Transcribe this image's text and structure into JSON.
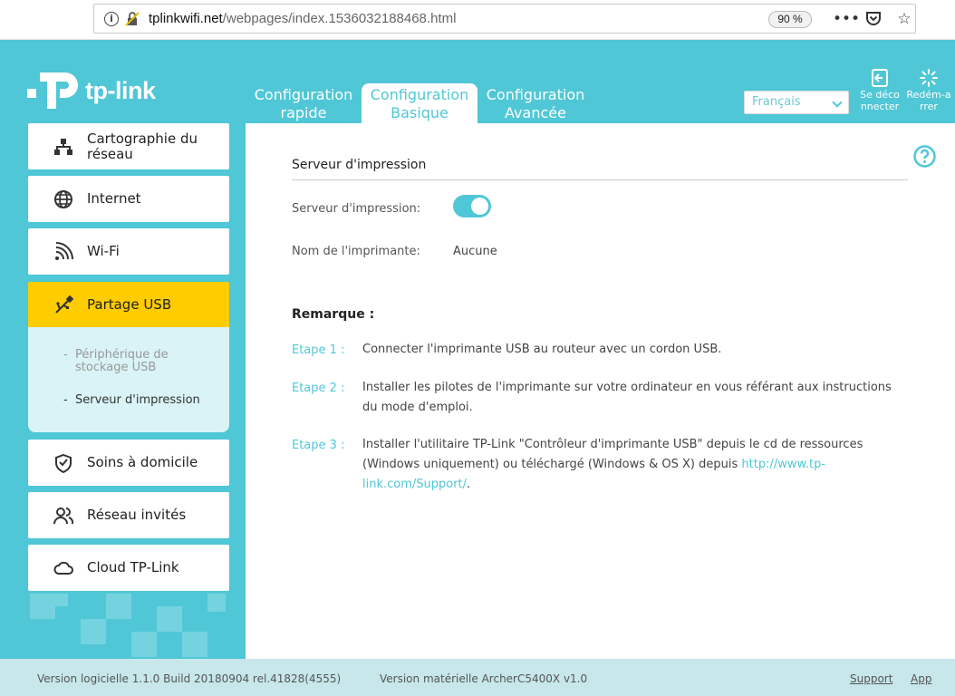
{
  "browser": {
    "url_host": "tplinkwifi.net",
    "url_path": "/webpages/index.1536032188468.html",
    "zoom": "90 %"
  },
  "header": {
    "brand": "tp-link",
    "tabs": [
      {
        "line1": "Configuration",
        "line2": "rapide"
      },
      {
        "line1": "Configuration",
        "line2": "Basique"
      },
      {
        "line1": "Configuration",
        "line2": "Avancée"
      }
    ],
    "language": "Français",
    "logout": {
      "line1": "Se déco",
      "line2": "nnecter"
    },
    "reboot": {
      "line1": "Redém-a",
      "line2": "rrer"
    }
  },
  "sidebar": {
    "items": [
      {
        "line1": "Cartographie du",
        "line2": "réseau"
      },
      {
        "label": "Internet"
      },
      {
        "label": "Wi-Fi"
      },
      {
        "label": "Partage USB"
      },
      {
        "label": "Soins à domicile"
      },
      {
        "label": "Réseau invités"
      },
      {
        "label": "Cloud TP-Link"
      }
    ],
    "submenu": [
      {
        "line1": "Périphérique de",
        "line2": "stockage USB"
      },
      {
        "label": "Serveur d'impression"
      }
    ]
  },
  "main": {
    "section_title": "Serveur d'impression",
    "print_server_label": "Serveur d'impression:",
    "print_server_enabled": true,
    "printer_name_label": "Nom de l'imprimante:",
    "printer_name_value": "Aucune",
    "remark_title": "Remarque :",
    "steps": [
      {
        "label": "Etape 1 :",
        "text": "Connecter l'imprimante USB au routeur avec un cordon USB."
      },
      {
        "label": "Etape 2 :",
        "text": "Installer les pilotes de l'imprimante sur votre ordinateur en vous référant aux instructions du mode d'emploi."
      },
      {
        "label": "Etape 3 :",
        "text": "Installer l'utilitaire TP-Link \"Contrôleur d'imprimante USB\" depuis le cd de ressources (Windows uniquement) ou téléchargé (Windows & OS X) depuis ",
        "link": "http://www.tp-link.com/Support/",
        "suffix": "."
      }
    ]
  },
  "footer": {
    "software": "Version logicielle 1.1.0 Build 20180904 rel.41828(4555)",
    "hardware": "Version matérielle ArcherC5400X v1.0",
    "support": "Support",
    "app": "App"
  },
  "colors": {
    "accent": "#4fc7d6",
    "active": "#ffcc00"
  }
}
